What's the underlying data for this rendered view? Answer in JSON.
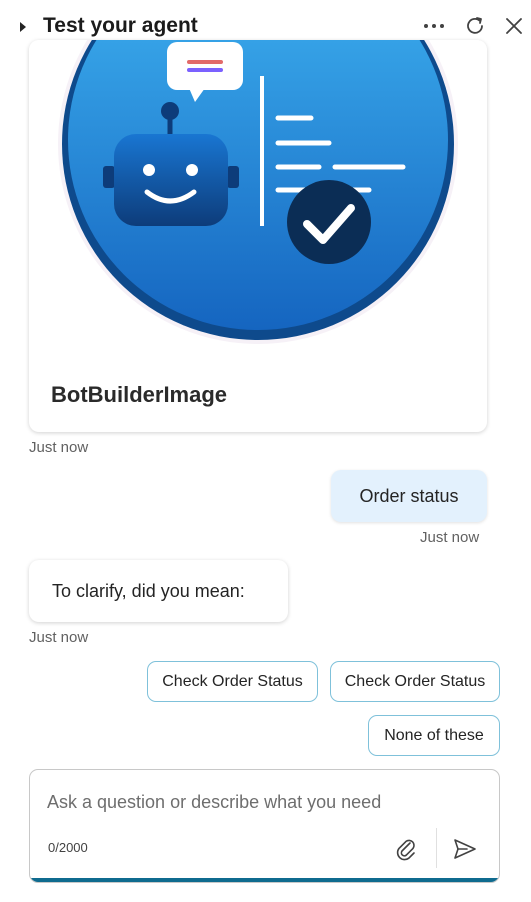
{
  "header": {
    "title": "Test your agent",
    "icons": [
      "caret-right-icon",
      "more-icon",
      "refresh-icon",
      "close-icon"
    ]
  },
  "card": {
    "title": "BotBuilderImage",
    "timestamp": "Just now",
    "image_icons": [
      "robot-icon",
      "checkmark-icon"
    ]
  },
  "messages": {
    "user": {
      "text": "Order status",
      "timestamp": "Just now"
    },
    "bot": {
      "text": "To clarify, did you mean:",
      "timestamp": "Just now"
    }
  },
  "suggested_actions": [
    {
      "label": "Check Order Status"
    },
    {
      "label": "Check Order Status"
    },
    {
      "label": "None of these"
    }
  ],
  "composer": {
    "placeholder": "Ask a question or describe what you need",
    "value": "",
    "char_count": "0/2000",
    "icons": [
      "attach-icon",
      "send-icon"
    ]
  },
  "colors": {
    "user_bubble": "#e3f1fd",
    "chip_border": "#7fc1da",
    "composer_accent": "#0f6b8f",
    "image_circle": "#1e88e5"
  }
}
